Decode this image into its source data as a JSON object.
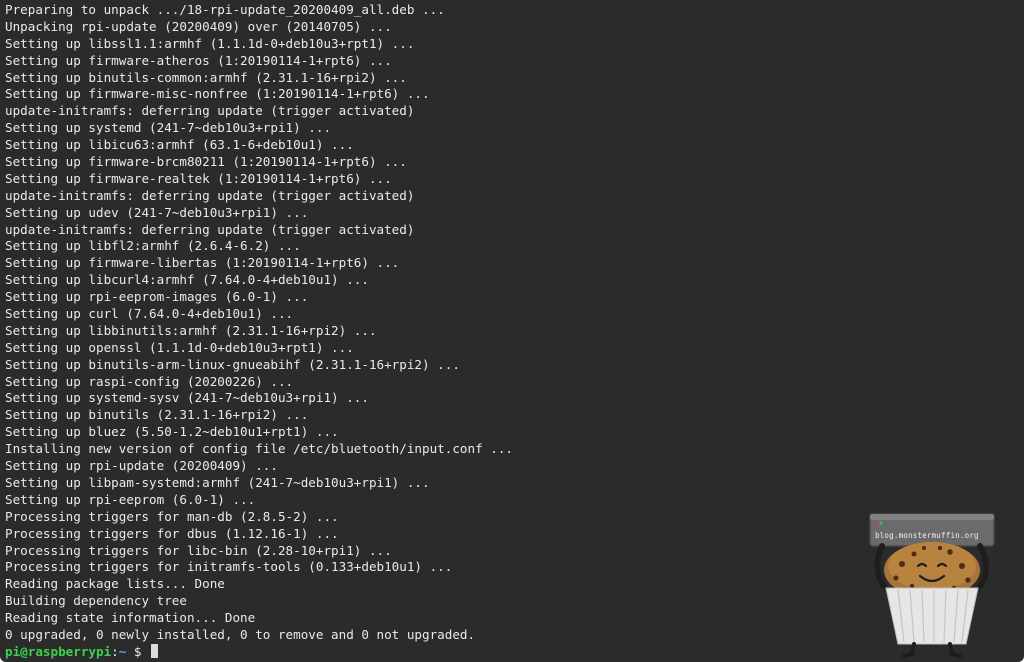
{
  "terminal": {
    "output_lines": [
      "Preparing to unpack .../18-rpi-update_20200409_all.deb ...",
      "Unpacking rpi-update (20200409) over (20140705) ...",
      "Setting up libssl1.1:armhf (1.1.1d-0+deb10u3+rpt1) ...",
      "Setting up firmware-atheros (1:20190114-1+rpt6) ...",
      "Setting up binutils-common:armhf (2.31.1-16+rpi2) ...",
      "Setting up firmware-misc-nonfree (1:20190114-1+rpt6) ...",
      "update-initramfs: deferring update (trigger activated)",
      "Setting up systemd (241-7~deb10u3+rpi1) ...",
      "Setting up libicu63:armhf (63.1-6+deb10u1) ...",
      "Setting up firmware-brcm80211 (1:20190114-1+rpt6) ...",
      "Setting up firmware-realtek (1:20190114-1+rpt6) ...",
      "update-initramfs: deferring update (trigger activated)",
      "Setting up udev (241-7~deb10u3+rpi1) ...",
      "update-initramfs: deferring update (trigger activated)",
      "Setting up libfl2:armhf (2.6.4-6.2) ...",
      "Setting up firmware-libertas (1:20190114-1+rpt6) ...",
      "Setting up libcurl4:armhf (7.64.0-4+deb10u1) ...",
      "Setting up rpi-eeprom-images (6.0-1) ...",
      "Setting up curl (7.64.0-4+deb10u1) ...",
      "Setting up libbinutils:armhf (2.31.1-16+rpi2) ...",
      "Setting up openssl (1.1.1d-0+deb10u3+rpt1) ...",
      "Setting up binutils-arm-linux-gnueabihf (2.31.1-16+rpi2) ...",
      "Setting up raspi-config (20200226) ...",
      "Setting up systemd-sysv (241-7~deb10u3+rpi1) ...",
      "Setting up binutils (2.31.1-16+rpi2) ...",
      "Setting up bluez (5.50-1.2~deb10u1+rpt1) ...",
      "Installing new version of config file /etc/bluetooth/input.conf ...",
      "Setting up rpi-update (20200409) ...",
      "Setting up libpam-systemd:armhf (241-7~deb10u3+rpi1) ...",
      "Setting up rpi-eeprom (6.0-1) ...",
      "Processing triggers for man-db (2.8.5-2) ...",
      "Processing triggers for dbus (1.12.16-1) ...",
      "Processing triggers for libc-bin (2.28-10+rpi1) ...",
      "Processing triggers for initramfs-tools (0.133+deb10u1) ...",
      "Reading package lists... Done",
      "Building dependency tree",
      "Reading state information... Done",
      "0 upgraded, 0 newly installed, 0 to remove and 0 not upgraded."
    ],
    "prompt": {
      "user_host": "pi@raspberrypi",
      "separator": ":",
      "path": "~",
      "symbol": " $ "
    },
    "colors": {
      "background": "#2b2b2b",
      "text": "#eaeaea",
      "prompt_user": "#3fd14b",
      "prompt_path": "#5aa0ff"
    }
  },
  "watermark": {
    "label": "blog.monstermuffin.org",
    "icon": "muffin-mascot-icon"
  }
}
